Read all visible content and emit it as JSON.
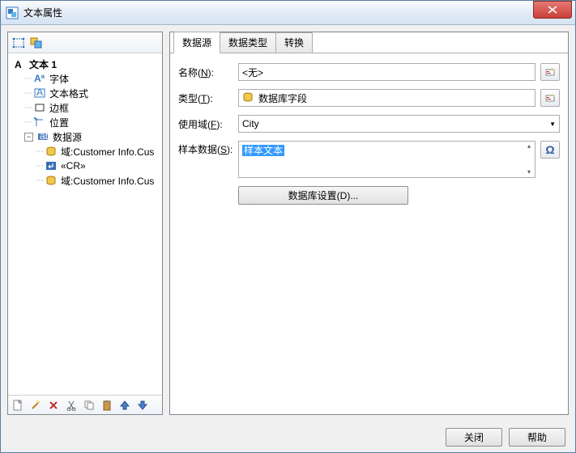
{
  "window": {
    "title": "文本属性"
  },
  "tree": {
    "root": "文本 1",
    "nodes": [
      {
        "icon": "font",
        "label": "字体"
      },
      {
        "icon": "textfmt",
        "label": "文本格式"
      },
      {
        "icon": "border",
        "label": "边框"
      },
      {
        "icon": "position",
        "label": "位置"
      },
      {
        "icon": "datasource",
        "label": "数据源"
      }
    ],
    "ds_children": [
      {
        "icon": "db",
        "label": "域:Customer Info.Cus"
      },
      {
        "icon": "cr",
        "label": "«CR»"
      },
      {
        "icon": "db",
        "label": "域:Customer Info.Cus"
      }
    ]
  },
  "tabs": [
    {
      "label": "数据源",
      "active": true
    },
    {
      "label": "数据类型",
      "active": false
    },
    {
      "label": "转换",
      "active": false
    }
  ],
  "form": {
    "name_label": "名称(N):",
    "name_value": "<无>",
    "type_label": "类型(T):",
    "type_value": "数据库字段",
    "field_label": "使用域(F):",
    "field_value": "City",
    "sample_label": "样本数据(S):",
    "sample_value": "样本文本",
    "settings_button": "数据库设置(D)..."
  },
  "footer": {
    "close": "关闭",
    "help": "帮助"
  }
}
